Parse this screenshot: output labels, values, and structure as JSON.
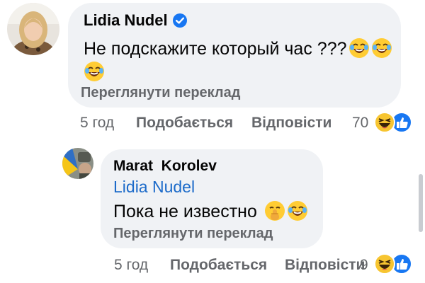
{
  "comments": [
    {
      "author": "Lidia Nudel",
      "verified": true,
      "text_line1": "Не подскажите который час ???",
      "text_line1_emojis": [
        "laughing-crying-emoji",
        "laughing-crying-emoji"
      ],
      "text_line2_emojis": [
        "laughing-crying-emoji"
      ],
      "translate_label": "Переглянути переклад",
      "time": "5 год",
      "like_label": "Подобається",
      "reply_label": "Відповісти",
      "reaction_count": "70",
      "reactions": [
        "haha-reaction-icon",
        "like-reaction-icon"
      ]
    },
    {
      "author": "Marat  Korolev",
      "mention": "Lidia Nudel",
      "text_line1": "Пока не известно",
      "text_line1_emojis": [
        "shushing-face-emoji",
        "laughing-crying-emoji"
      ],
      "translate_label": "Переглянути переклад",
      "time": "5 год",
      "like_label": "Подобається",
      "reply_label": "Відповісти",
      "reaction_count": "9",
      "reactions": [
        "haha-reaction-icon",
        "like-reaction-icon"
      ]
    }
  ],
  "colors": {
    "bubble": "#f0f2f5",
    "link": "#1b6ac9",
    "muted": "#65676b",
    "like_blue": "#1877f2",
    "haha_yellow": "#f7c531"
  }
}
